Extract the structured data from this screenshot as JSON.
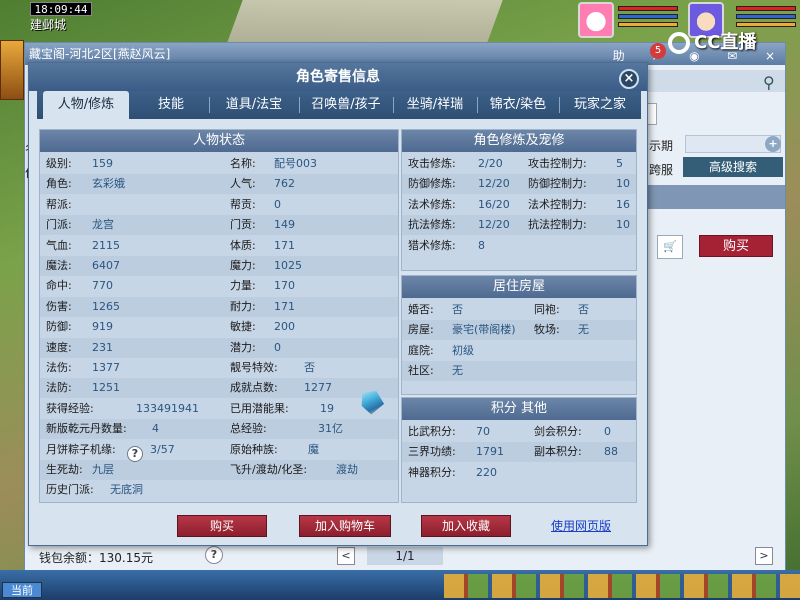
{
  "game": {
    "clock": "18:09:44",
    "location": "建邺城",
    "channel": "当前"
  },
  "stream": {
    "logo_text": "CC直播"
  },
  "back_window": {
    "title": "藏宝阁-河北2区[燕赵风云]",
    "actions": {
      "assist": "助",
      "share_icon": "share-icon",
      "stop_icon": "stop-icon",
      "chat_icon": "chat-icon",
      "close": "×"
    },
    "notify_count": "5",
    "expire_label": "示期",
    "cross_server_label": "跨服",
    "advanced_search": "高级搜索",
    "buy": "购买",
    "left_labels": [
      "名",
      "价"
    ],
    "wallet": "钱包余额：130.15元",
    "help": "?",
    "pager_prev": "<",
    "pager_label": "1/1",
    "pager_next": ">"
  },
  "dialog": {
    "title": "角色寄售信息",
    "close": "×",
    "tabs": [
      {
        "label": "人物/修炼"
      },
      {
        "label": "技能"
      },
      {
        "label": "道具/法宝"
      },
      {
        "label": "召唤兽/孩子"
      },
      {
        "label": "坐骑/祥瑞"
      },
      {
        "label": "锦衣/染色"
      },
      {
        "label": "玩家之家"
      }
    ],
    "status": {
      "title": "人物状态",
      "rows": [
        {
          "l1": "级别:",
          "v1": "159",
          "l2": "名称:",
          "v2": "配号003"
        },
        {
          "l1": "角色:",
          "v1": "玄彩娥",
          "l2": "人气:",
          "v2": "762"
        },
        {
          "l1": "帮派:",
          "v1": "",
          "l2": "帮贡:",
          "v2": "0"
        },
        {
          "l1": "门派:",
          "v1": "龙宫",
          "l2": "门贡:",
          "v2": "149"
        },
        {
          "l1": "气血:",
          "v1": "2115",
          "l2": "体质:",
          "v2": "171"
        },
        {
          "l1": "魔法:",
          "v1": "6407",
          "l2": "魔力:",
          "v2": "1025"
        },
        {
          "l1": "命中:",
          "v1": "770",
          "l2": "力量:",
          "v2": "170"
        },
        {
          "l1": "伤害:",
          "v1": "1265",
          "l2": "耐力:",
          "v2": "171"
        },
        {
          "l1": "防御:",
          "v1": "919",
          "l2": "敏捷:",
          "v2": "200"
        },
        {
          "l1": "速度:",
          "v1": "231",
          "l2": "潜力:",
          "v2": "0"
        },
        {
          "l1": "法伤:",
          "v1": "1377",
          "l2": "靓号特效:",
          "v2": "否"
        },
        {
          "l1": "法防:",
          "v1": "1251",
          "l2": "成就点数:",
          "v2": "1277"
        },
        {
          "l1": "获得经验:",
          "v1": "133491941",
          "l2": "已用潜能果:",
          "v2": "19"
        },
        {
          "l1": "新版乾元丹数量:",
          "v1": "4",
          "l2": "总经验:",
          "v2": "31亿"
        },
        {
          "l1": "月饼粽子机缘:",
          "v1": "3/57",
          "l2": "原始种族:",
          "v2": "魔"
        },
        {
          "l1": "生死劫:",
          "v1": "九层",
          "l2": "飞升/渡劫/化圣:",
          "v2": "渡劫"
        },
        {
          "l1": "历史门派:",
          "v1": "无底洞",
          "l2": "",
          "v2": ""
        }
      ]
    },
    "cultivation": {
      "title": "角色修炼及宠修",
      "rows": [
        {
          "l1": "攻击修炼:",
          "v1": "2/20",
          "l2": "攻击控制力:",
          "v2": "5"
        },
        {
          "l1": "防御修炼:",
          "v1": "12/20",
          "l2": "防御控制力:",
          "v2": "10"
        },
        {
          "l1": "法术修炼:",
          "v1": "16/20",
          "l2": "法术控制力:",
          "v2": "16"
        },
        {
          "l1": "抗法修炼:",
          "v1": "12/20",
          "l2": "抗法控制力:",
          "v2": "10"
        },
        {
          "l1": "猎术修炼:",
          "v1": "8",
          "l2": "",
          "v2": ""
        }
      ]
    },
    "housing": {
      "title": "居住房屋",
      "rows": [
        {
          "l1": "婚否:",
          "v1": "否",
          "l2": "同袍:",
          "v2": "否"
        },
        {
          "l1": "房屋:",
          "v1": "豪宅(带阁楼)",
          "l2": "牧场:",
          "v2": "无"
        },
        {
          "l1": "庭院:",
          "v1": "初级",
          "l2": "",
          "v2": ""
        },
        {
          "l1": "社区:",
          "v1": "无",
          "l2": "",
          "v2": ""
        }
      ]
    },
    "points": {
      "title": "积分 其他",
      "rows": [
        {
          "l1": "比武积分:",
          "v1": "70",
          "l2": "剑会积分:",
          "v2": "0"
        },
        {
          "l1": "三界功绩:",
          "v1": "1791",
          "l2": "副本积分:",
          "v2": "88"
        },
        {
          "l1": "神器积分:",
          "v1": "220",
          "l2": "",
          "v2": ""
        }
      ]
    },
    "help": "?",
    "actions": {
      "buy": "购买",
      "add_cart": "加入购物车",
      "favorite": "加入收藏",
      "web_link": "使用网页版"
    }
  },
  "colors": {
    "accent_red": "#a42234",
    "header_blue": "#3a5c86",
    "value_blue": "#2a5680"
  }
}
